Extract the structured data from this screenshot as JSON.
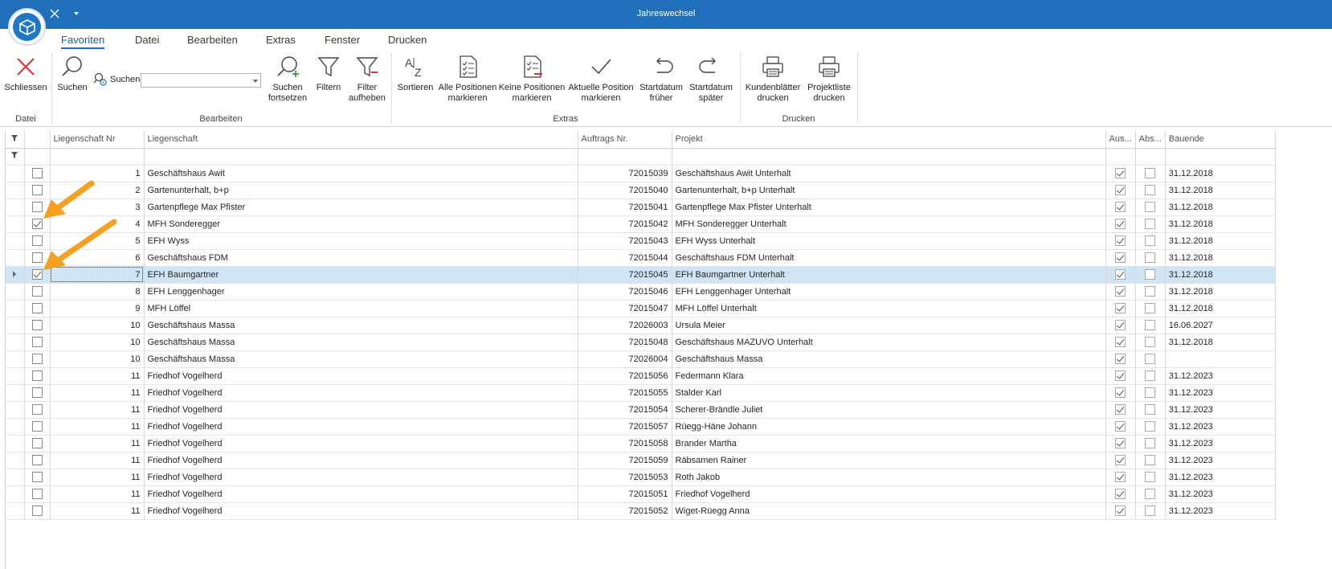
{
  "window": {
    "title": "Jahreswechsel"
  },
  "ribbon_tabs": [
    "Favoriten",
    "Datei",
    "Bearbeiten",
    "Extras",
    "Fenster",
    "Drucken"
  ],
  "ribbon": {
    "groups": {
      "datei": "Datei",
      "bearbeiten": "Bearbeiten",
      "extras": "Extras",
      "drucken": "Drucken"
    },
    "buttons": {
      "schliessen": "Schliessen",
      "suchen": "Suchen",
      "suchen_small": "Suchen",
      "suchen_fortsetzen_1": "Suchen",
      "suchen_fortsetzen_2": "fortsetzen",
      "filtern": "Filtern",
      "filter_aufheben_1": "Filter",
      "filter_aufheben_2": "aufheben",
      "sortieren": "Sortieren",
      "alle_1": "Alle Positionen",
      "alle_2": "markieren",
      "keine_1": "Keine Positionen",
      "keine_2": "markieren",
      "aktuelle_1": "Aktuelle Position",
      "aktuelle_2": "markieren",
      "frueher_1": "Startdatum",
      "frueher_2": "früher",
      "spaeter_1": "Startdatum",
      "spaeter_2": "später",
      "kunden_1": "Kundenblätter",
      "kunden_2": "drucken",
      "projekt_1": "Projektliste",
      "projekt_2": "drucken"
    },
    "search_value": ""
  },
  "grid": {
    "columns": {
      "nr": "Liegenschaft Nr",
      "liegenschaft": "Liegenschaft",
      "auftrag": "Auftrags Nr.",
      "projekt": "Projekt",
      "aus": "Aus...",
      "abs": "Abs...",
      "bauende": "Bauende"
    },
    "rows": [
      {
        "checked": false,
        "nr": "1",
        "liegenschaft": "Geschäftshaus Awit",
        "auftrag": "72015039",
        "projekt": "Geschäftshaus Awit Unterhalt",
        "aus": true,
        "abs": false,
        "bauende": "31.12.2018"
      },
      {
        "checked": false,
        "nr": "2",
        "liegenschaft": "Gartenunterhalt, b+p",
        "auftrag": "72015040",
        "projekt": "Gartenunterhalt, b+p Unterhalt",
        "aus": true,
        "abs": false,
        "bauende": "31.12.2018"
      },
      {
        "checked": false,
        "nr": "3",
        "liegenschaft": "Gartenpflege Max Pfister",
        "auftrag": "72015041",
        "projekt": "Gartenpflege Max Pfister Unterhalt",
        "aus": true,
        "abs": false,
        "bauende": "31.12.2018"
      },
      {
        "checked": true,
        "nr": "4",
        "liegenschaft": "MFH Sonderegger",
        "auftrag": "72015042",
        "projekt": "MFH Sonderegger Unterhalt",
        "aus": true,
        "abs": false,
        "bauende": "31.12.2018"
      },
      {
        "checked": false,
        "nr": "5",
        "liegenschaft": "EFH Wyss",
        "auftrag": "72015043",
        "projekt": "EFH Wyss Unterhalt",
        "aus": true,
        "abs": false,
        "bauende": "31.12.2018"
      },
      {
        "checked": false,
        "nr": "6",
        "liegenschaft": "Geschäftshaus FDM",
        "auftrag": "72015044",
        "projekt": "Geschäftshaus FDM Unterhalt",
        "aus": true,
        "abs": false,
        "bauende": "31.12.2018"
      },
      {
        "checked": true,
        "nr": "7",
        "liegenschaft": "EFH Baumgartner",
        "auftrag": "72015045",
        "projekt": "EFH Baumgartner Unterhalt",
        "aus": true,
        "abs": false,
        "bauende": "31.12.2018",
        "selected": true
      },
      {
        "checked": false,
        "nr": "8",
        "liegenschaft": "EFH Lenggenhager",
        "auftrag": "72015046",
        "projekt": "EFH Lenggenhager Unterhalt",
        "aus": true,
        "abs": false,
        "bauende": "31.12.2018"
      },
      {
        "checked": false,
        "nr": "9",
        "liegenschaft": "MFH Löffel",
        "auftrag": "72015047",
        "projekt": "MFH Löffel Unterhalt",
        "aus": true,
        "abs": false,
        "bauende": "31.12.2018"
      },
      {
        "checked": false,
        "nr": "10",
        "liegenschaft": "Geschäftshaus Massa",
        "auftrag": "72026003",
        "projekt": "Ursula Meier",
        "aus": true,
        "abs": false,
        "bauende": "16.06.2027"
      },
      {
        "checked": false,
        "nr": "10",
        "liegenschaft": "Geschäftshaus Massa",
        "auftrag": "72015048",
        "projekt": "Geschäftshaus MAZUVO Unterhalt",
        "aus": true,
        "abs": false,
        "bauende": "31.12.2018"
      },
      {
        "checked": false,
        "nr": "10",
        "liegenschaft": "Geschäftshaus Massa",
        "auftrag": "72026004",
        "projekt": "Geschäftshaus Massa",
        "aus": true,
        "abs": false,
        "bauende": ""
      },
      {
        "checked": false,
        "nr": "11",
        "liegenschaft": "Friedhof Vogelherd",
        "auftrag": "72015056",
        "projekt": "Federmann Klara",
        "aus": true,
        "abs": false,
        "bauende": "31.12.2023"
      },
      {
        "checked": false,
        "nr": "11",
        "liegenschaft": "Friedhof Vogelherd",
        "auftrag": "72015055",
        "projekt": "Stalder Karl",
        "aus": true,
        "abs": false,
        "bauende": "31.12.2023"
      },
      {
        "checked": false,
        "nr": "11",
        "liegenschaft": "Friedhof Vogelherd",
        "auftrag": "72015054",
        "projekt": "Scherer-Brändle Juliet",
        "aus": true,
        "abs": false,
        "bauende": "31.12.2023"
      },
      {
        "checked": false,
        "nr": "11",
        "liegenschaft": "Friedhof Vogelherd",
        "auftrag": "72015057",
        "projekt": "Rüegg-Häne Johann",
        "aus": true,
        "abs": false,
        "bauende": "31.12.2023"
      },
      {
        "checked": false,
        "nr": "11",
        "liegenschaft": "Friedhof Vogelherd",
        "auftrag": "72015058",
        "projekt": "Brander Martha",
        "aus": true,
        "abs": false,
        "bauende": "31.12.2023"
      },
      {
        "checked": false,
        "nr": "11",
        "liegenschaft": "Friedhof Vogelherd",
        "auftrag": "72015059",
        "projekt": "Räbsamen Rainer",
        "aus": true,
        "abs": false,
        "bauende": "31.12.2023"
      },
      {
        "checked": false,
        "nr": "11",
        "liegenschaft": "Friedhof Vogelherd",
        "auftrag": "72015053",
        "projekt": "Roth Jakob",
        "aus": true,
        "abs": false,
        "bauende": "31.12.2023"
      },
      {
        "checked": false,
        "nr": "11",
        "liegenschaft": "Friedhof Vogelherd",
        "auftrag": "72015051",
        "projekt": "Friedhof Vogelherd",
        "aus": true,
        "abs": false,
        "bauende": "31.12.2023"
      },
      {
        "checked": false,
        "nr": "11",
        "liegenschaft": "Friedhof Vogelherd",
        "auftrag": "72015052",
        "projekt": "Wiget-Rüegg Anna",
        "aus": true,
        "abs": false,
        "bauende": "31.12.2023"
      }
    ]
  },
  "colors": {
    "titlebar": "#1f6fba",
    "selected_row": "#cfe4f5",
    "annotation_arrow": "#f5a020",
    "close_red": "#e03030"
  }
}
